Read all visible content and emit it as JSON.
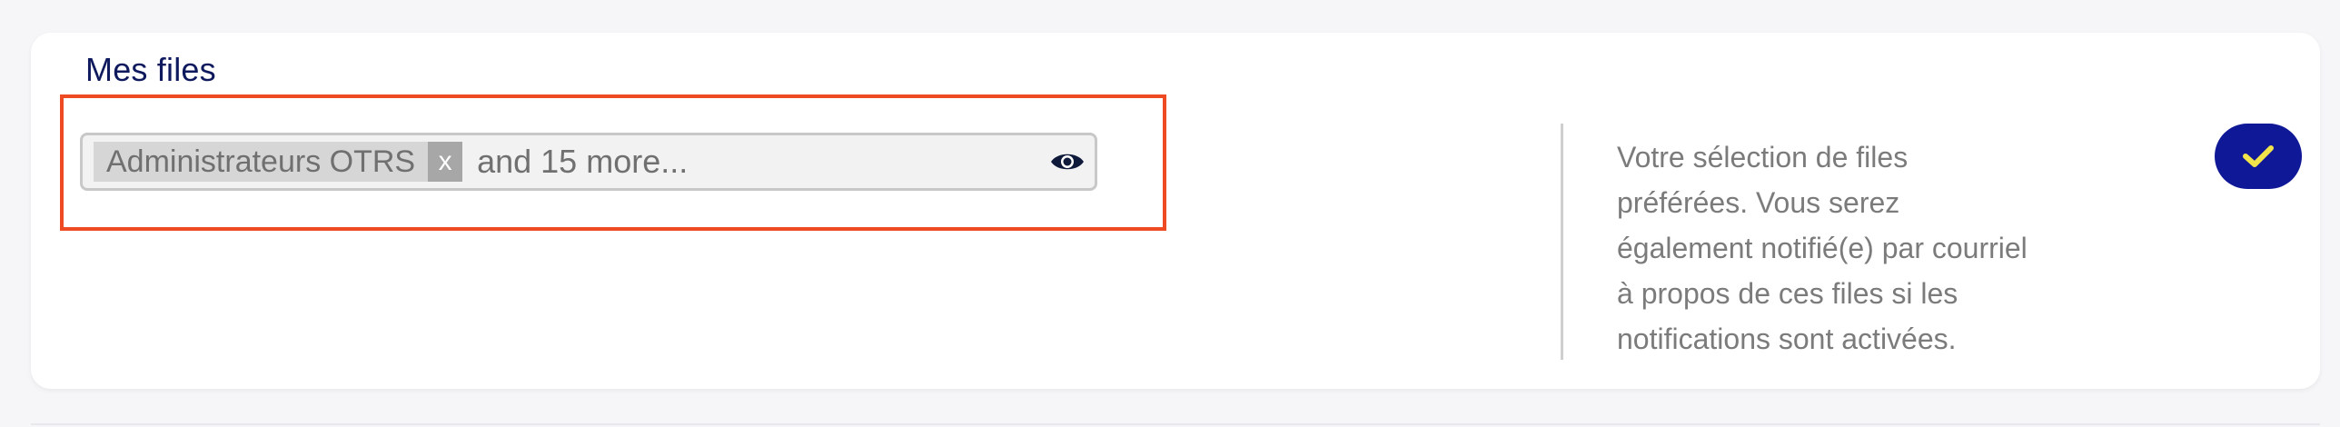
{
  "section": {
    "title": "Mes files"
  },
  "queue_field": {
    "tags": [
      {
        "label": "Administrateurs OTRS",
        "remove_label": "x"
      }
    ],
    "more_text": "and 15 more...",
    "toggle_icon": "eye-icon"
  },
  "help_text": {
    "lines": [
      "Votre sélection de files",
      "préférées. Vous serez",
      "également notifié(e) par courriel",
      "à propos de ces files si les",
      "notifications sont activées."
    ]
  },
  "save_button": {
    "icon": "checkmark-icon"
  },
  "colors": {
    "title": "#0f1a5e",
    "highlight": "#ee4b24",
    "save_bg": "#0f1896",
    "checkmark": "#f1e44a"
  }
}
